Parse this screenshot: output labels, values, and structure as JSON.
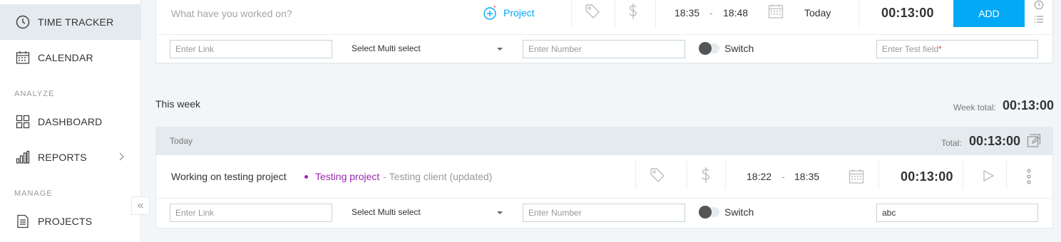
{
  "sidebar": {
    "items": [
      {
        "label": "TIME TRACKER",
        "icon": "clock-icon",
        "active": true
      },
      {
        "label": "CALENDAR",
        "icon": "calendar-icon"
      },
      {
        "label": "DASHBOARD",
        "icon": "dashboard-icon"
      },
      {
        "label": "REPORTS",
        "icon": "reports-icon"
      },
      {
        "label": "PROJECTS",
        "icon": "projects-icon"
      }
    ],
    "sections": {
      "analyze": "ANALYZE",
      "manage": "MANAGE"
    },
    "collapse_glyph": "«"
  },
  "tracker": {
    "description_placeholder": "What have you worked on?",
    "project_label": "Project",
    "start_time": "18:35",
    "dash": "-",
    "end_time": "18:48",
    "date": "Today",
    "duration": "00:13:00",
    "add_label": "ADD",
    "fields": {
      "link_placeholder": "Enter Link",
      "multi_select": "Select Multi select",
      "number_placeholder": "Enter Number",
      "switch_label": "Switch",
      "test_placeholder": "Enter Test field",
      "required_mark": "*"
    }
  },
  "week": {
    "title": "This week",
    "total_label": "Week total:",
    "total_value": "00:13:00"
  },
  "day": {
    "label": "Today",
    "total_label": "Total:",
    "total_value": "00:13:00"
  },
  "entry": {
    "description": "Working on testing project",
    "project": "Testing project",
    "client": "- Testing client (updated)",
    "start_time": "18:22",
    "dash": "-",
    "end_time": "18:35",
    "duration": "00:13:00",
    "fields": {
      "link_placeholder": "Enter Link",
      "multi_select": "Select Multi select",
      "number_placeholder": "Enter Number",
      "switch_label": "Switch",
      "test_value": "abc"
    }
  },
  "colors": {
    "accent": "#03a9f4",
    "project": "#9c27b0",
    "required": "#f44336"
  }
}
